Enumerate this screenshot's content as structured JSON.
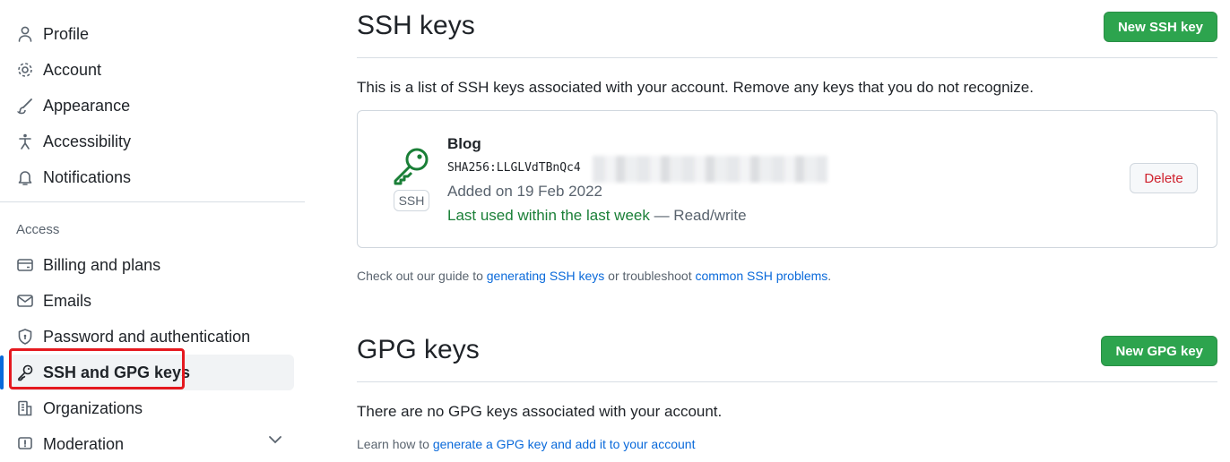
{
  "sidebar": {
    "items_top": [
      {
        "label": "Profile",
        "icon": "person-icon"
      },
      {
        "label": "Account",
        "icon": "gear-icon"
      },
      {
        "label": "Appearance",
        "icon": "paintbrush-icon"
      },
      {
        "label": "Accessibility",
        "icon": "accessibility-icon"
      },
      {
        "label": "Notifications",
        "icon": "bell-icon"
      }
    ],
    "section_label": "Access",
    "items_access": [
      {
        "label": "Billing and plans",
        "icon": "credit-card-icon"
      },
      {
        "label": "Emails",
        "icon": "mail-icon"
      },
      {
        "label": "Password and authentication",
        "icon": "shield-lock-icon"
      },
      {
        "label": "SSH and GPG keys",
        "icon": "key-icon",
        "active": true
      },
      {
        "label": "Organizations",
        "icon": "organization-icon"
      },
      {
        "label": "Moderation",
        "icon": "report-icon"
      }
    ]
  },
  "ssh": {
    "title": "SSH keys",
    "new_button": "New SSH key",
    "description": "This is a list of SSH keys associated with your account. Remove any keys that you do not recognize.",
    "key": {
      "badge": "SSH",
      "name": "Blog",
      "fingerprint": "SHA256:LLGLVdTBnQc4",
      "added": "Added on 19 Feb 2022",
      "last_used": "Last used within the last week",
      "access": " — Read/write",
      "delete_button": "Delete"
    },
    "guide": {
      "prefix": "Check out our guide to ",
      "link1": "generating SSH keys",
      "middle": " or troubleshoot ",
      "link2": "common SSH problems",
      "suffix": "."
    }
  },
  "gpg": {
    "title": "GPG keys",
    "new_button": "New GPG key",
    "description": "There are no GPG keys associated with your account.",
    "learn_prefix": "Learn how to ",
    "learn_link": "generate a GPG key and add it to your account"
  },
  "colors": {
    "accent": "#0969da",
    "primary_button": "#2da44e",
    "danger": "#cf222e",
    "success_text": "#1a7f37",
    "annotation_box": "#e5191f"
  }
}
